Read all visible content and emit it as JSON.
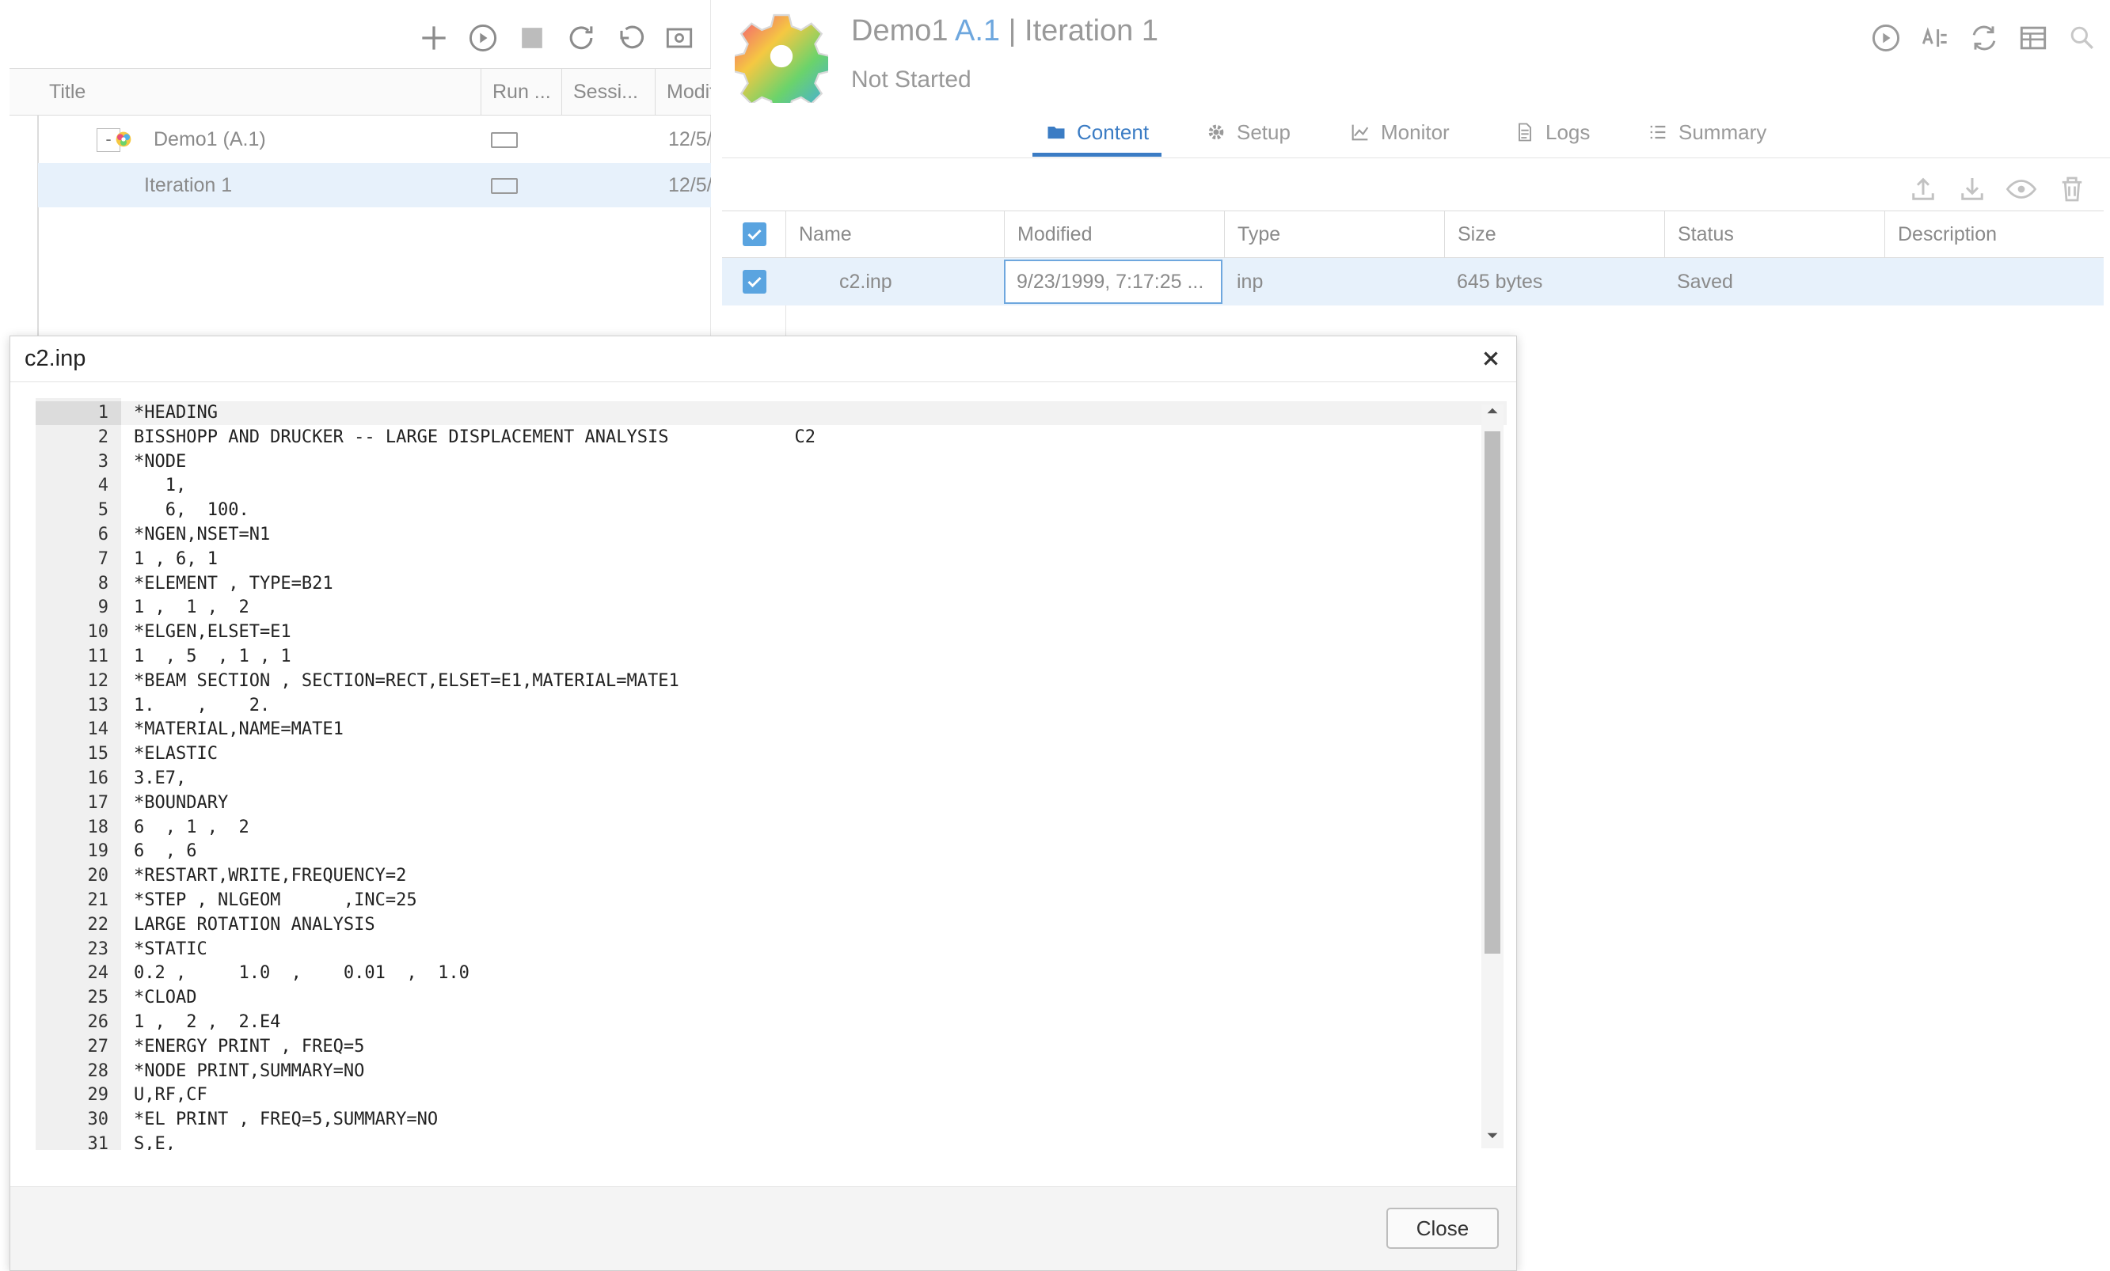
{
  "left_toolbar": {
    "icons": [
      "plus-icon",
      "play-circle-icon",
      "stop-icon",
      "refresh-icon",
      "undo-icon",
      "view-icon"
    ]
  },
  "tree": {
    "columns": [
      "Title",
      "Run ...",
      "Sessi...",
      "Modif"
    ],
    "rows": [
      {
        "title": "Demo1 (A.1)",
        "modified": "12/5/",
        "expander": "-"
      },
      {
        "title": "Iteration 1",
        "modified": "12/5/"
      }
    ]
  },
  "header": {
    "job_name": "Demo1",
    "version": "A.1",
    "iteration": "| Iteration 1",
    "status": "Not Started"
  },
  "tabs": [
    {
      "label": "Content",
      "icon": "folder-icon",
      "active": true
    },
    {
      "label": "Setup",
      "icon": "gear-icon",
      "active": false
    },
    {
      "label": "Monitor",
      "icon": "chart-icon",
      "active": false
    },
    {
      "label": "Logs",
      "icon": "document-icon",
      "active": false
    },
    {
      "label": "Summary",
      "icon": "list-icon",
      "active": false
    }
  ],
  "file_table": {
    "columns": [
      "Name",
      "Modified",
      "Type",
      "Size",
      "Status",
      "Description"
    ],
    "rows": [
      {
        "name": "c2.inp",
        "modified": "9/23/1999, 7:17:25 ...",
        "type": "inp",
        "size": "645 bytes",
        "status": "Saved",
        "description": ""
      }
    ]
  },
  "dialog": {
    "title": "c2.inp",
    "close_label": "Close",
    "lines": [
      "*HEADING",
      "BISSHOPP AND DRUCKER -- LARGE DISPLACEMENT ANALYSIS            C2",
      "*NODE",
      "   1,",
      "   6,  100.",
      "*NGEN,NSET=N1",
      "1 , 6, 1",
      "*ELEMENT , TYPE=B21",
      "1 ,  1 ,  2",
      "*ELGEN,ELSET=E1",
      "1  , 5  , 1 , 1",
      "*BEAM SECTION , SECTION=RECT,ELSET=E1,MATERIAL=MATE1",
      "1.    ,    2.",
      "*MATERIAL,NAME=MATE1",
      "*ELASTIC",
      "3.E7,",
      "*BOUNDARY",
      "6  , 1 ,  2",
      "6  , 6",
      "*RESTART,WRITE,FREQUENCY=2",
      "*STEP , NLGEOM      ,INC=25",
      "LARGE ROTATION ANALYSIS",
      "*STATIC",
      "0.2 ,     1.0  ,    0.01  ,  1.0",
      "*CLOAD",
      "1 ,  2 ,  2.E4",
      "*ENERGY PRINT , FREQ=5",
      "*NODE PRINT,SUMMARY=NO",
      "U,RF,CF",
      "*EL PRINT , FREQ=5,SUMMARY=NO",
      "S,E,"
    ]
  },
  "colors": {
    "accent": "#3b7cc4",
    "selection": "#e7f1fb",
    "checkbox": "#5aa4e0"
  }
}
